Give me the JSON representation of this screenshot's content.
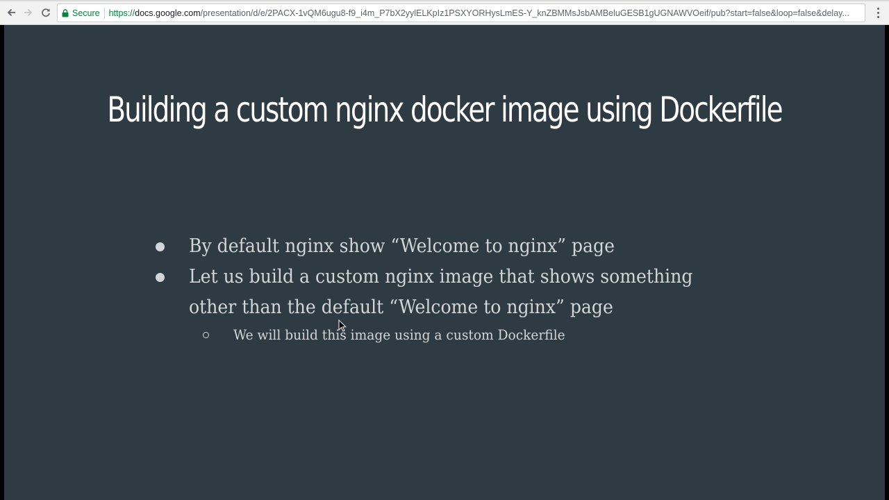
{
  "browser": {
    "secure_label": "Secure",
    "url_scheme": "https://",
    "url_host": "docs.google.com",
    "url_rest": "/presentation/d/e/2PACX-1vQM6ugu8-f9_i4m_P7bX2yylELKpIz1PSXYORHysLmES-Y_knZBMMsJsbAMBeluGESB1gUGNAWVOeif/pub?start=false&loop=false&delay...",
    "colors": {
      "secure": "#0b8043",
      "toolbar_bg": "#f2f2f2"
    },
    "icons": [
      "back-arrow-icon",
      "forward-arrow-icon",
      "reload-icon",
      "lock-icon",
      "more-vert-icon"
    ]
  },
  "slide": {
    "title": "Building a custom nginx docker image using Dockerfile",
    "bullets": [
      {
        "lines": [
          "By default nginx show “Welcome to nginx” page"
        ]
      },
      {
        "lines": [
          "Let us build a custom nginx image that shows something",
          "other than the default “Welcome to nginx” page"
        ],
        "sub_bullets": [
          "We will build this image using a custom Dockerfile"
        ]
      }
    ],
    "colors": {
      "background": "#2f3b42",
      "title": "#ffffff",
      "body_text": "#d2d6d8"
    }
  }
}
